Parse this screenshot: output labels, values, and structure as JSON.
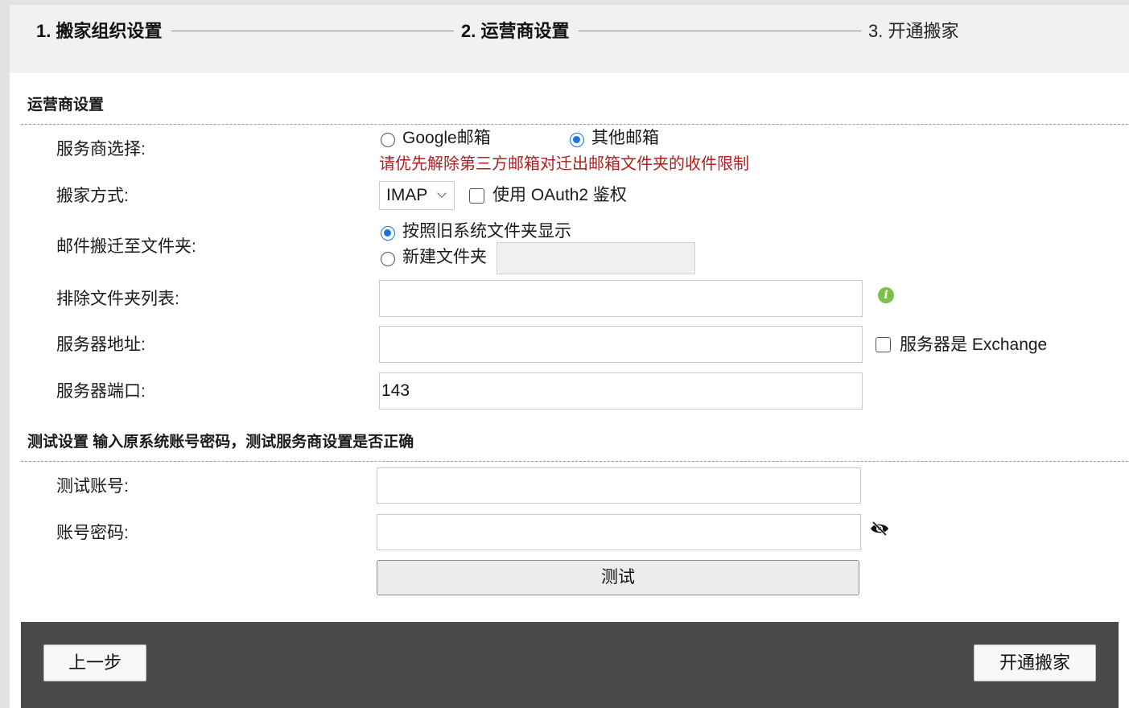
{
  "steps": [
    {
      "label": "1. 搬家组织设置",
      "state": "active"
    },
    {
      "label": "2. 运营商设置",
      "state": "active"
    },
    {
      "label": "3. 开通搬家",
      "state": "pending"
    }
  ],
  "provider_section": {
    "title": "运营商设置",
    "provider": {
      "label": "服务商选择:",
      "options": [
        "Google邮箱",
        "其他邮箱"
      ],
      "selected": "其他邮箱",
      "warning": "请优先解除第三方邮箱对迁出邮箱文件夹的收件限制"
    },
    "method": {
      "label": "搬家方式:",
      "value": "IMAP",
      "oauth_label": "使用 OAuth2 鉴权",
      "oauth_checked": false
    },
    "target_folder": {
      "label": "邮件搬迁至文件夹:",
      "options": [
        "按照旧系统文件夹显示",
        "新建文件夹"
      ],
      "selected": "按照旧系统文件夹显示",
      "new_folder_value": ""
    },
    "exclude_folders": {
      "label": "排除文件夹列表:",
      "value": ""
    },
    "server_address": {
      "label": "服务器地址:",
      "value": "",
      "exchange_label": "服务器是 Exchange",
      "exchange_checked": false
    },
    "server_port": {
      "label": "服务器端口:",
      "value": "143"
    }
  },
  "test_section": {
    "title": "测试设置 输入原系统账号密码，测试服务商设置是否正确",
    "account": {
      "label": "测试账号:",
      "value": ""
    },
    "password": {
      "label": "账号密码:",
      "value": ""
    },
    "test_button": "测试"
  },
  "footer": {
    "prev_button": "上一步",
    "submit_button": "开通搬家"
  },
  "colors": {
    "accent": "#1a73e8",
    "warning": "#b01e1e",
    "info_icon": "#7cc24a",
    "footer_bg": "#4a4a4a"
  }
}
